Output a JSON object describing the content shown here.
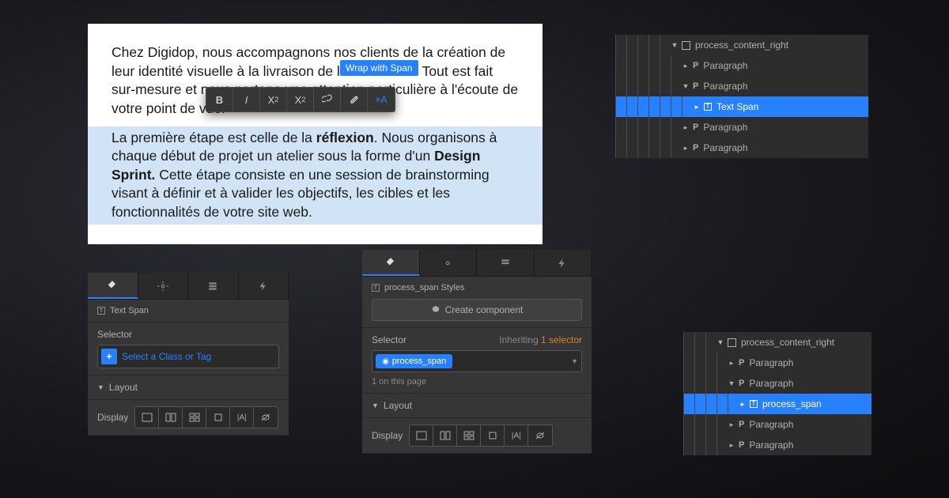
{
  "editor": {
    "paragraph1": "Chez Digidop, nous accompagnons nos clients de la création de leur identité visuelle à la livraison de leur site web. Tout est fait sur-mesure et nous portons une attention particulière à l'écoute de votre point de vue.",
    "paragraph2_prefix": "La première étape est celle de la ",
    "paragraph2_bold1": "réflexion",
    "paragraph2_mid": ". Nous organisons à chaque début de projet un atelier sous la forme d'un ",
    "paragraph2_bold2": "Design Sprint.",
    "paragraph2_suffix": " Cette étape consiste en une session de brainstorming visant à définir et à valider les objectifs, les cibles et les fonctionnalités de votre site web.",
    "tooltip": "Wrap with Span",
    "toolbar": {
      "bold": "B",
      "italic": "I",
      "sup_base": "X",
      "sup": "2",
      "sub_base": "X",
      "sub": "2",
      "xa": "×A"
    }
  },
  "nav1": {
    "container": "process_content_right",
    "items": [
      "Paragraph",
      "Paragraph",
      "Text Span",
      "Paragraph",
      "Paragraph"
    ]
  },
  "nav2": {
    "container": "process_content_right",
    "items": [
      "Paragraph",
      "Paragraph",
      "process_span",
      "Paragraph",
      "Paragraph"
    ]
  },
  "panel1": {
    "breadcrumb": "Text Span",
    "selector_label": "Selector",
    "placeholder": "Select a Class or Tag",
    "layout": "Layout",
    "display": "Display"
  },
  "panel2": {
    "breadcrumb": "process_span Styles",
    "create": "Create component",
    "selector_label": "Selector",
    "inheriting": "Inheriting",
    "inherit_count": "1 selector",
    "tag": "process_span",
    "count": "1 on this page",
    "layout": "Layout",
    "display": "Display"
  }
}
